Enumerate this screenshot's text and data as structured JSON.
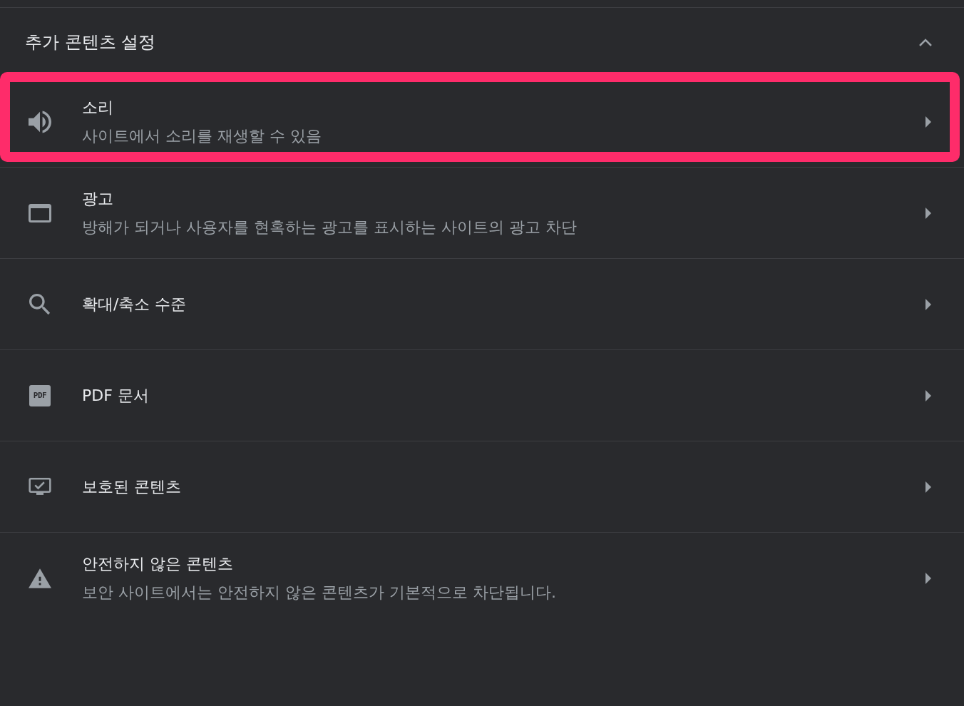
{
  "section": {
    "title": "추가 콘텐츠 설정",
    "expanded": true
  },
  "rows": [
    {
      "kind": "sound",
      "title": "소리",
      "subtitle": "사이트에서 소리를 재생할 수 있음",
      "highlighted": true
    },
    {
      "kind": "ads",
      "title": "광고",
      "subtitle": "방해가 되거나 사용자를 현혹하는 광고를 표시하는 사이트의 광고 차단",
      "highlighted": false
    },
    {
      "kind": "zoom",
      "title": "확대/축소 수준",
      "highlighted": false
    },
    {
      "kind": "pdf",
      "title": "PDF 문서",
      "icon_label": "PDF",
      "highlighted": false
    },
    {
      "kind": "protected",
      "title": "보호된 콘텐츠",
      "highlighted": false
    },
    {
      "kind": "insecure",
      "title": "안전하지 않은 콘텐츠",
      "subtitle": "보안 사이트에서는 안전하지 않은 콘텐츠가 기본적으로 차단됩니다.",
      "highlighted": false
    }
  ]
}
